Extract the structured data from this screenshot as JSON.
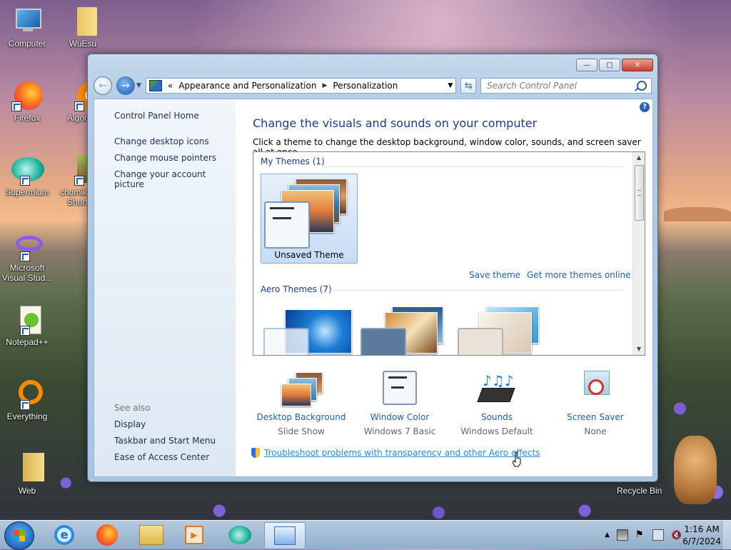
{
  "desktop": {
    "icons": [
      {
        "label": "Computer"
      },
      {
        "label": "WuEsu"
      },
      {
        "label": "Firefox"
      },
      {
        "label": "Algoo"
      },
      {
        "label": "Supermium"
      },
      {
        "label": "chomik"
      },
      {
        "label": "Short"
      },
      {
        "label": "Microsoft"
      },
      {
        "label": "Visual Stud..."
      },
      {
        "label": "Notepad++"
      },
      {
        "label": "Everything"
      },
      {
        "label": "Web"
      },
      {
        "label": "Recycle Bin"
      }
    ]
  },
  "window": {
    "controls": {
      "minimize": "—",
      "maximize": "□",
      "close": "✕"
    },
    "address": {
      "prefix": "«",
      "crumb1": "Appearance and Personalization",
      "separator": "▶",
      "crumb2": "Personalization"
    },
    "search_placeholder": "Search Control Panel"
  },
  "sidebar": {
    "home": "Control Panel Home",
    "links": [
      "Change desktop icons",
      "Change mouse pointers",
      "Change your account picture"
    ],
    "see_also_title": "See also",
    "see_also": [
      "Display",
      "Taskbar and Start Menu",
      "Ease of Access Center"
    ]
  },
  "main": {
    "heading": "Change the visuals and sounds on your computer",
    "subtext": "Click a theme to change the desktop background, window color, sounds, and screen saver all at once.",
    "my_themes_title": "My Themes (1)",
    "unsaved_theme": "Unsaved Theme",
    "save_theme": "Save theme",
    "get_more": "Get more themes online",
    "aero_title": "Aero Themes (7)",
    "bottom": [
      {
        "label": "Desktop Background",
        "sub": "Slide Show"
      },
      {
        "label": "Window Color",
        "sub": "Windows 7 Basic"
      },
      {
        "label": "Sounds",
        "sub": "Windows Default"
      },
      {
        "label": "Screen Saver",
        "sub": "None"
      }
    ],
    "troubleshoot": "Troubleshoot problems with transparency and other Aero effects"
  },
  "taskbar": {
    "time": "1:16 AM",
    "date": "6/7/2024"
  },
  "colors": {
    "link": "#1e5fb4",
    "heading": "#1e3a8a"
  }
}
